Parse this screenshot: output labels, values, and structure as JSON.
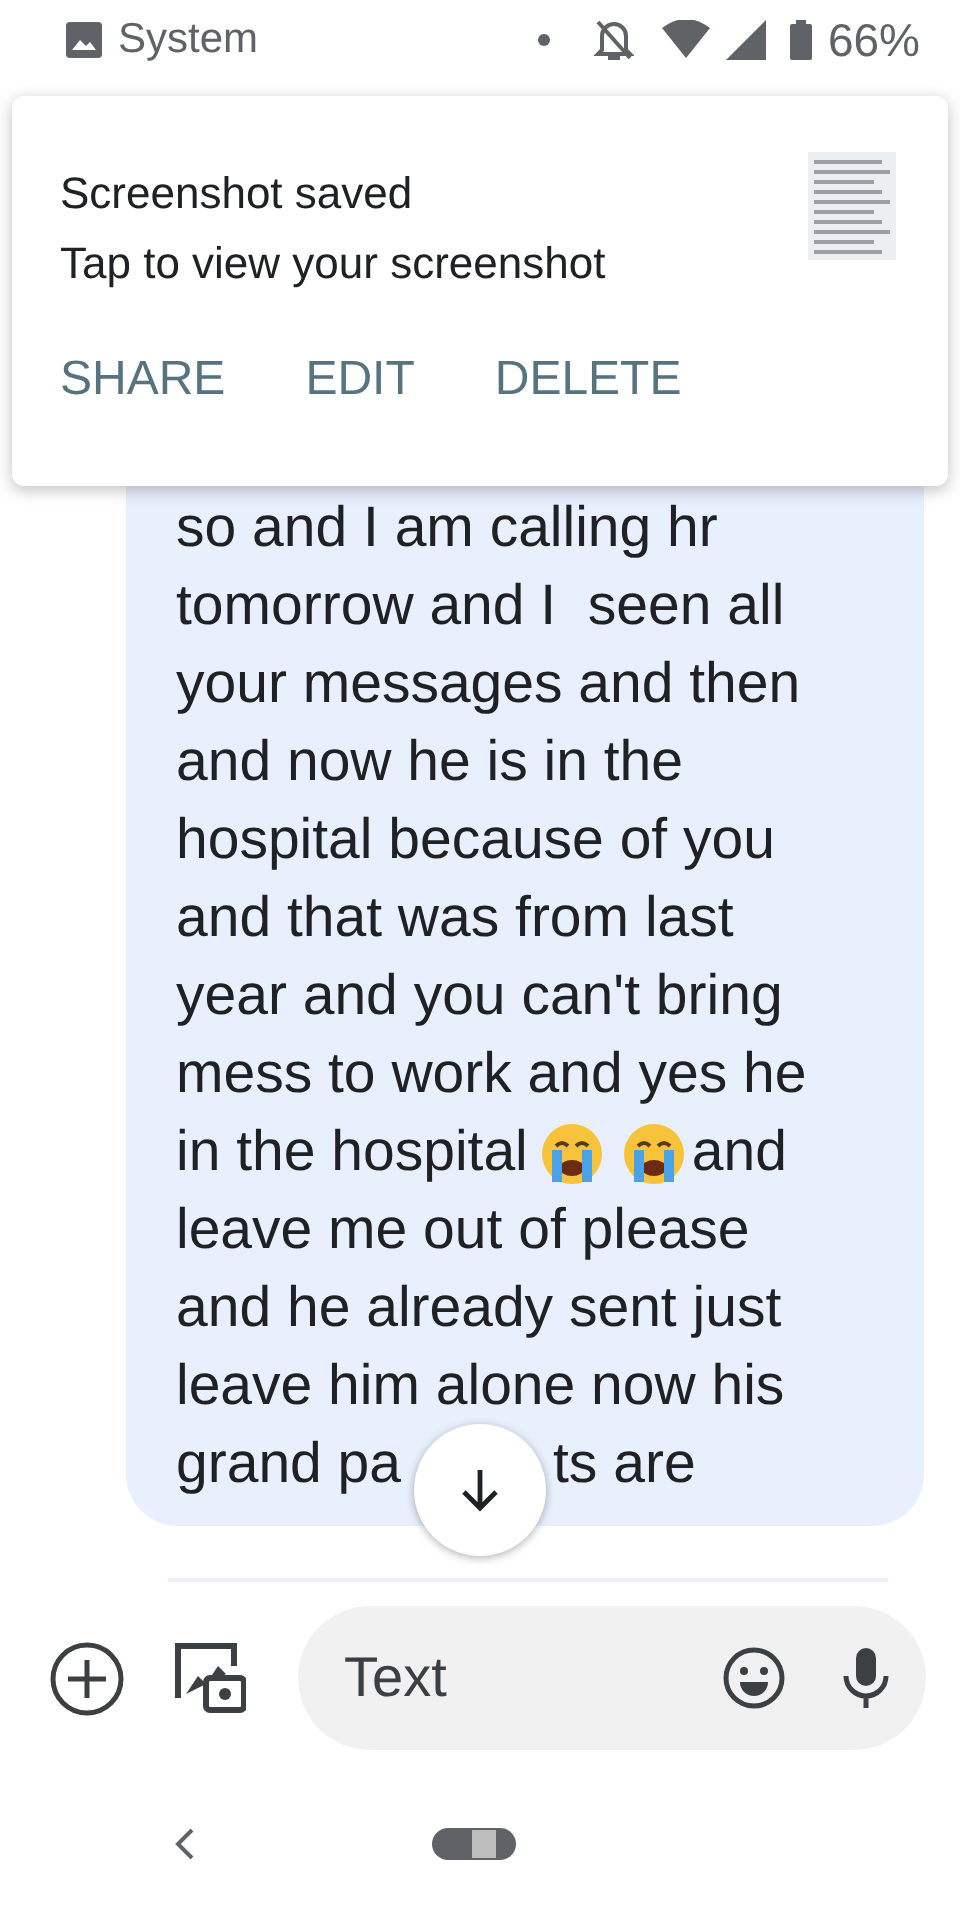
{
  "status_bar": {
    "app": "System",
    "battery": "66%"
  },
  "notification": {
    "title": "Screenshot saved",
    "text": "Tap to view your screenshot",
    "actions": [
      "SHARE",
      "EDIT",
      "DELETE"
    ]
  },
  "message": {
    "lines": [
      [
        {
          "kind": "text",
          "text": "so and I am calling hr"
        }
      ],
      [
        {
          "kind": "text",
          "text": "tomorrow and I  seen all"
        }
      ],
      [
        {
          "kind": "text",
          "text": "your messages and then"
        }
      ],
      [
        {
          "kind": "text",
          "text": "and now he is in the"
        }
      ],
      [
        {
          "kind": "text",
          "text": "hospital because of you"
        }
      ],
      [
        {
          "kind": "text",
          "text": "and that was from last"
        }
      ],
      [
        {
          "kind": "text",
          "text": "year and you can't bring"
        }
      ],
      [
        {
          "kind": "text",
          "text": "mess to work and yes he"
        }
      ],
      [
        {
          "kind": "text",
          "text": "in the hospital"
        },
        {
          "kind": "emoji"
        },
        {
          "kind": "emoji"
        },
        {
          "kind": "text",
          "text": "and"
        }
      ],
      [
        {
          "kind": "text",
          "text": "leave me out of please"
        }
      ],
      [
        {
          "kind": "text",
          "text": "and he already sent just"
        }
      ],
      [
        {
          "kind": "text",
          "text": "leave him alone now his"
        }
      ],
      [
        {
          "kind": "text",
          "text": "grand pa"
        },
        {
          "kind": "covered"
        },
        {
          "kind": "text",
          "text": "ts are"
        }
      ]
    ]
  },
  "composer": {
    "placeholder": "Text"
  }
}
